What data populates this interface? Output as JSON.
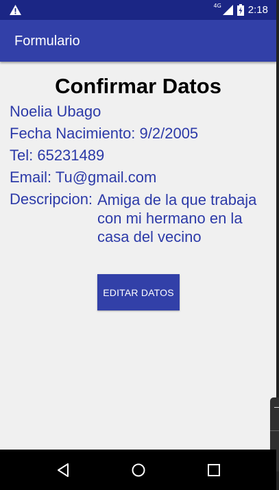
{
  "status_bar": {
    "network": "4G",
    "time": "2:18",
    "icons": [
      "warning-icon",
      "signal-icon",
      "battery-charging-icon"
    ]
  },
  "app_bar": {
    "title": "Formulario"
  },
  "main": {
    "heading": "Confirmar Datos",
    "name": "Noelia Ubago",
    "birth_date": "Fecha Nacimiento: 9/2/2005",
    "phone": "Tel: 65231489",
    "email": "Email: Tu@gmail.com",
    "description_label": "Descripcion:",
    "description_value": "Amiga de la que trabaja con mi hermano en la casa del vecino",
    "edit_button": "EDITAR DATOS"
  },
  "nav_bar": {
    "icons": [
      "back-icon",
      "home-icon",
      "recents-icon"
    ]
  },
  "colors": {
    "status_bar": "#1b2685",
    "app_bar": "#3240a8",
    "text_primary": "#2c3aa8",
    "background": "#f0f0f0"
  }
}
